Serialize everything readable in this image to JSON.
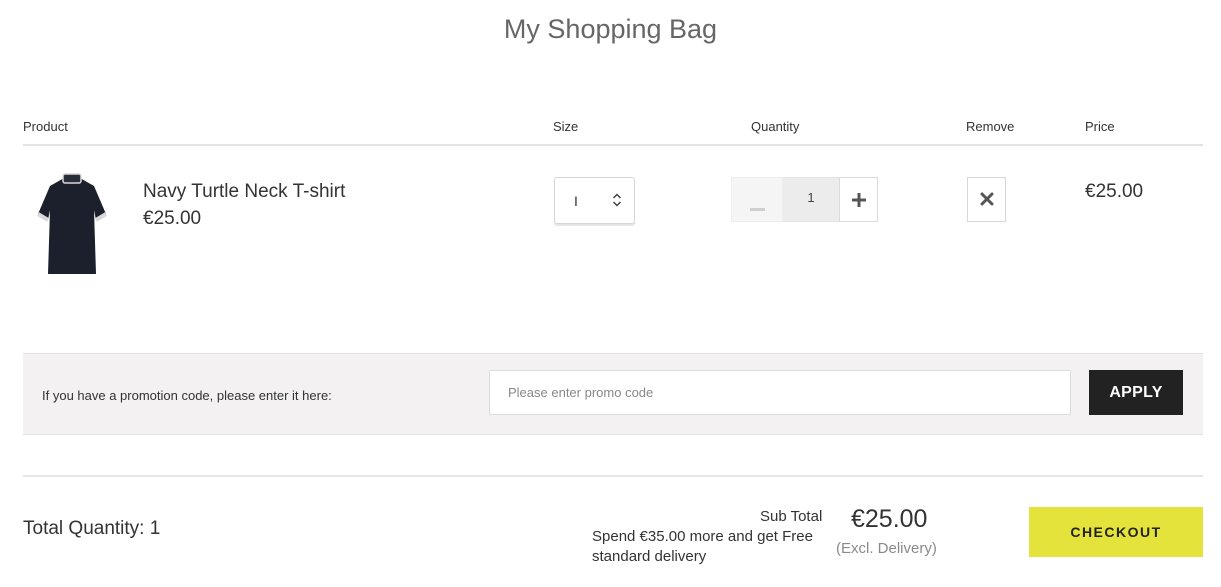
{
  "page": {
    "title": "My Shopping Bag"
  },
  "table": {
    "headers": {
      "product": "Product",
      "size": "Size",
      "quantity": "Quantity",
      "remove": "Remove",
      "price": "Price"
    }
  },
  "item": {
    "name": "Navy Turtle Neck T-shirt",
    "unit_price": "€25.00",
    "image_icon": "navy-turtle-neck-tshirt",
    "size_value": "I",
    "quantity": "1",
    "line_price": "€25.00",
    "colors": {
      "garment": "#1c1f2c",
      "trim": "#d9d9d9"
    }
  },
  "promo": {
    "label": "If you have a promotion code, please enter it here:",
    "placeholder": "Please enter promo code",
    "value": "",
    "apply_label": "APPLY"
  },
  "summary": {
    "total_quantity_label": "Total Quantity: 1",
    "subtotal_label": "Sub Total",
    "subtotal_value": "€25.00",
    "excl_delivery": "(Excl. Delivery)",
    "free_delivery_msg": "Spend €35.00 more and get Free standard delivery",
    "checkout_label": "CHECKOUT"
  },
  "colors": {
    "checkout_bg": "#e3e33b",
    "apply_bg": "#222222",
    "promo_bar_bg": "#f3f1f1"
  }
}
